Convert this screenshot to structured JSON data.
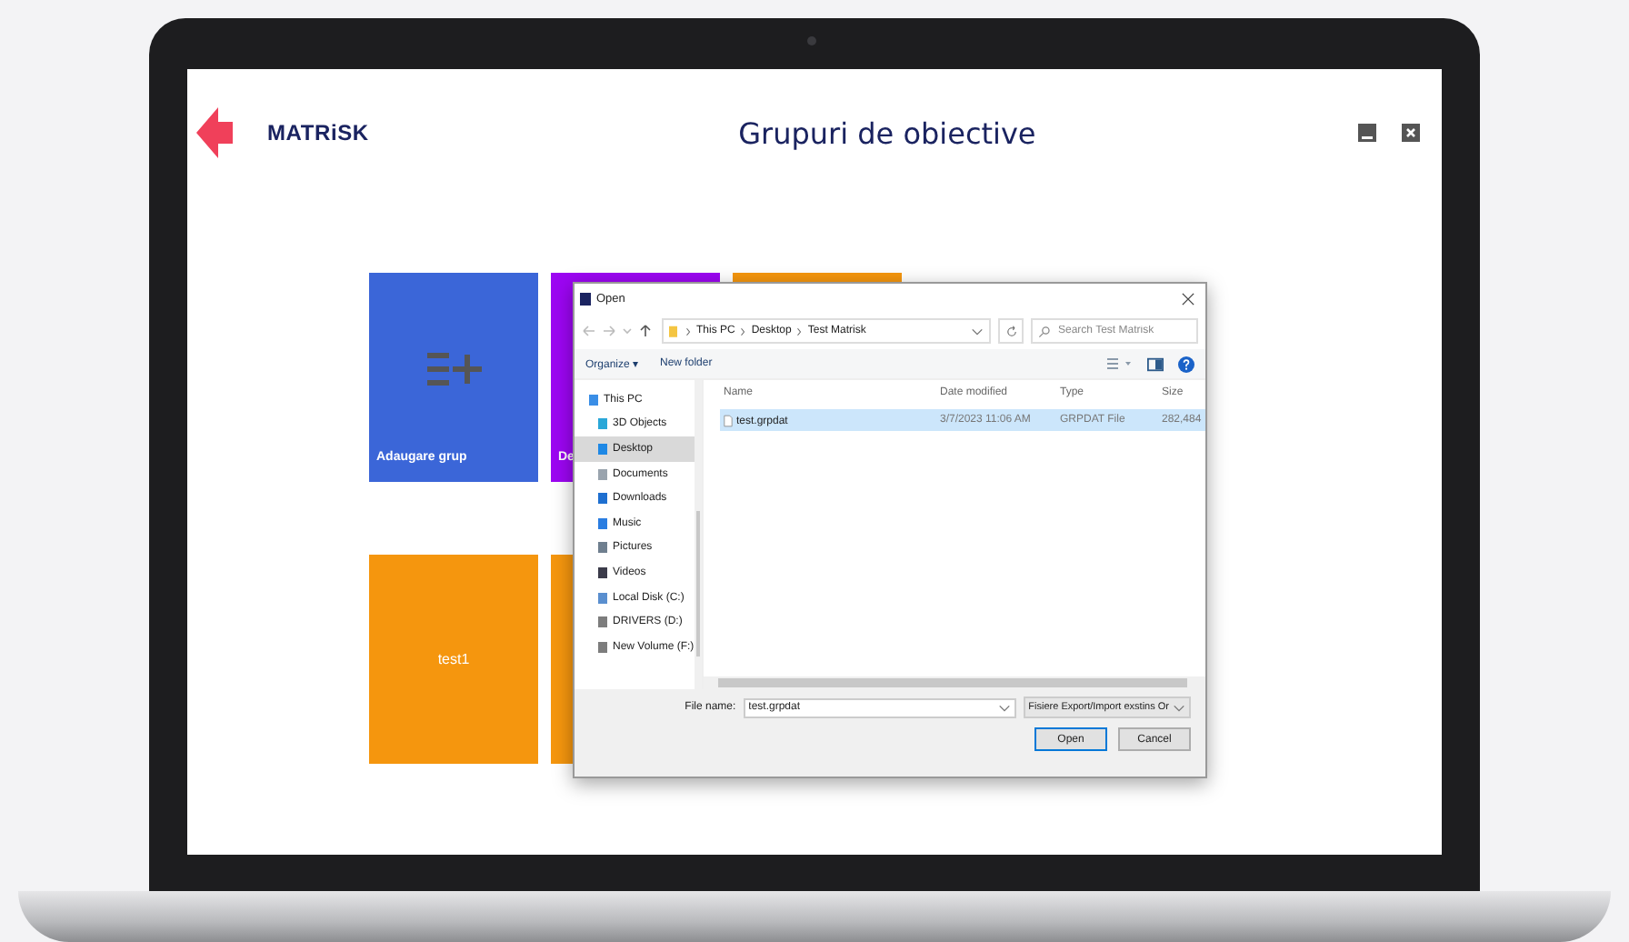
{
  "app": {
    "logo": "MATRiSK",
    "title": "Grupuri de obiective"
  },
  "tiles": [
    {
      "kind": "add",
      "label": "Adaugare grup",
      "color": "#3b66d8"
    },
    {
      "kind": "action",
      "label": "De",
      "color": "#9c06f2"
    },
    {
      "kind": "group",
      "color": "#f5960e"
    },
    {
      "kind": "group",
      "label": "test1",
      "color": "#f5960e"
    },
    {
      "kind": "group",
      "color": "#f5960e"
    }
  ],
  "dialog": {
    "title": "Open",
    "path": [
      "This PC",
      "Desktop",
      "Test Matrisk"
    ],
    "search": {
      "placeholder": "Search Test Matrisk"
    },
    "toolbar": [
      "Organize ▾",
      "New folder"
    ],
    "nav": [
      {
        "kind": "pc",
        "label": "This PC",
        "selected": false
      },
      {
        "kind": "cube",
        "label": "3D Objects",
        "selected": false
      },
      {
        "kind": "desktop",
        "label": "Desktop",
        "selected": true
      },
      {
        "kind": "docs",
        "label": "Documents",
        "selected": false
      },
      {
        "kind": "download",
        "label": "Downloads",
        "selected": false
      },
      {
        "kind": "music",
        "label": "Music",
        "selected": false
      },
      {
        "kind": "pictures",
        "label": "Pictures",
        "selected": false
      },
      {
        "kind": "videos",
        "label": "Videos",
        "selected": false
      },
      {
        "kind": "disk",
        "label": "Local Disk (C:)",
        "selected": false
      },
      {
        "kind": "drive",
        "label": "DRIVERS (D:)",
        "selected": false
      },
      {
        "kind": "drive",
        "label": "New Volume (F:)",
        "selected": false
      }
    ],
    "columns": [
      "Name",
      "Date modified",
      "Type",
      "Size"
    ],
    "files": [
      {
        "name": "test.grpdat",
        "date": "3/7/2023 11:06 AM",
        "type": "GRPDAT File",
        "size": "282,484",
        "selected": true
      }
    ],
    "file_name_label": "File name:",
    "file_name": "test.grpdat",
    "filter": "Fisiere Export/Import exstins Or",
    "buttons": [
      "Open",
      "Cancel"
    ]
  }
}
